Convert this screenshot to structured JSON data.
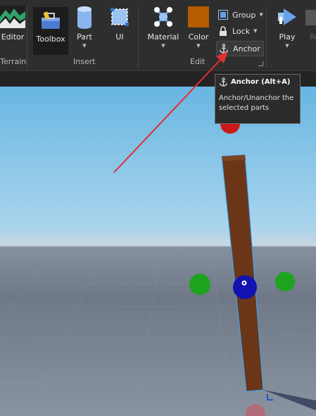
{
  "ribbon": {
    "terrain_editor": {
      "label": "Editor"
    },
    "toolbox": {
      "label": "Toolbox"
    },
    "part": {
      "label": "Part"
    },
    "ui": {
      "label": "UI"
    },
    "material": {
      "label": "Material"
    },
    "color": {
      "label": "Color",
      "swatch": "#b35c00"
    },
    "group": {
      "label": "Group"
    },
    "lock": {
      "label": "Lock"
    },
    "anchor": {
      "label": "Anchor"
    },
    "play": {
      "label": "Play"
    },
    "resume": {
      "label": "Re"
    },
    "groups": {
      "terrain": "Terrain",
      "insert": "Insert",
      "edit": "Edit"
    }
  },
  "tooltip": {
    "title": "Anchor (Alt+A)",
    "description_line1": "Anchor/Unanchor the",
    "description_line2": "selected parts"
  },
  "viewport": {
    "sky_color": "#6ab6e2",
    "baseplate_color": "#7d8693",
    "part_color": "#6b3617",
    "selection_color": "#33aaff",
    "handle_green": "#1ea31e",
    "handle_red": "#cc1a1a",
    "handle_blue": "#1a1acc"
  },
  "colors": {
    "annotation_arrow": "#e03030"
  }
}
